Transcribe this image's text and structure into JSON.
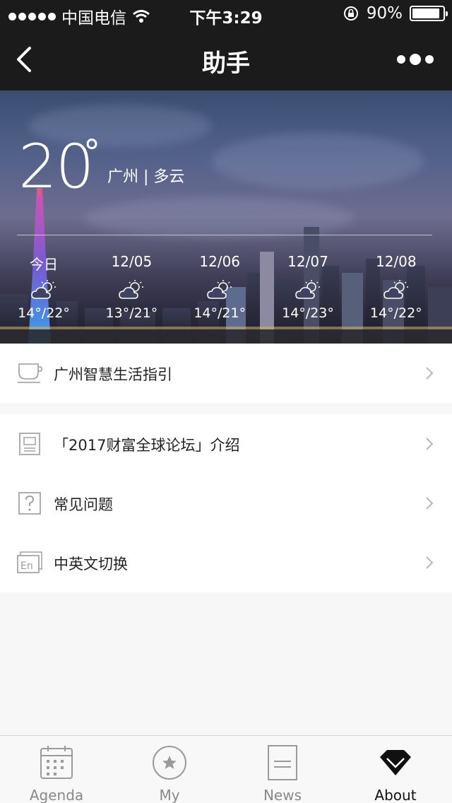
{
  "status_bar": {
    "carrier": "中国电信",
    "time": "下午3:29",
    "battery": "90%",
    "battery_level": 0.9
  },
  "nav": {
    "title": "助手",
    "back_icon": "chevron-left-icon",
    "more_icon": "more-dots-icon"
  },
  "weather": {
    "temperature": "20",
    "degree": "°",
    "city_condition": "广州 | 多云",
    "forecast": [
      {
        "date": "今日",
        "range": "14°/22°",
        "icon": "partly-cloudy-icon"
      },
      {
        "date": "12/05",
        "range": "13°/21°",
        "icon": "partly-cloudy-icon"
      },
      {
        "date": "12/06",
        "range": "14°/21°",
        "icon": "partly-cloudy-icon"
      },
      {
        "date": "12/07",
        "range": "14°/23°",
        "icon": "partly-cloudy-icon"
      },
      {
        "date": "12/08",
        "range": "14°/22°",
        "icon": "partly-cloudy-icon"
      }
    ]
  },
  "menu": {
    "guide": {
      "label": "广州智慧生活指引",
      "icon": "cup-icon"
    },
    "items": [
      {
        "label": "「2017财富全球论坛」介绍",
        "icon": "document-icon"
      },
      {
        "label": "常见问题",
        "icon": "question-icon"
      },
      {
        "label": "中英文切换",
        "icon": "language-icon"
      }
    ]
  },
  "tabs": [
    {
      "label": "Agenda",
      "icon": "calendar-icon",
      "active": false
    },
    {
      "label": "My",
      "icon": "star-icon",
      "active": false
    },
    {
      "label": "News",
      "icon": "news-icon",
      "active": false
    },
    {
      "label": "About",
      "icon": "diamond-icon",
      "active": true
    }
  ],
  "colors": {
    "bar_background": "#1b1b1b",
    "page_background": "#f7f7f7",
    "icon_gray": "#9a9a9a"
  }
}
